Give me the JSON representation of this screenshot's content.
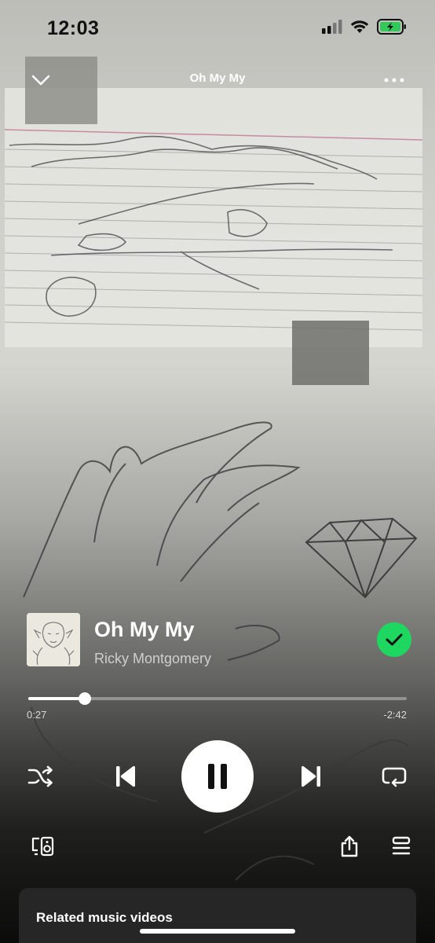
{
  "status_bar": {
    "time": "12:03",
    "icons": [
      "cellular-signal-icon",
      "wifi-icon",
      "battery-charging-icon"
    ],
    "battery_color": "#34c759"
  },
  "header": {
    "title": "Oh My My",
    "collapse_icon": "chevron-down-icon",
    "more_icon": "more-horizontal-icon"
  },
  "track": {
    "title": "Oh My My",
    "artist": "Ricky Montgomery",
    "saved": true,
    "saved_color": "#1ed760"
  },
  "progress": {
    "elapsed": "0:27",
    "remaining": "-2:42",
    "fraction": 0.15
  },
  "controls": {
    "shuffle_icon": "shuffle-icon",
    "previous_icon": "skip-previous-icon",
    "play_state": "playing",
    "play_icon": "pause-icon",
    "next_icon": "skip-next-icon",
    "repeat_icon": "repeat-icon"
  },
  "bottom_row": {
    "devices_icon": "connect-device-icon",
    "share_icon": "share-icon",
    "queue_icon": "queue-icon"
  },
  "related": {
    "label": "Related music videos"
  }
}
